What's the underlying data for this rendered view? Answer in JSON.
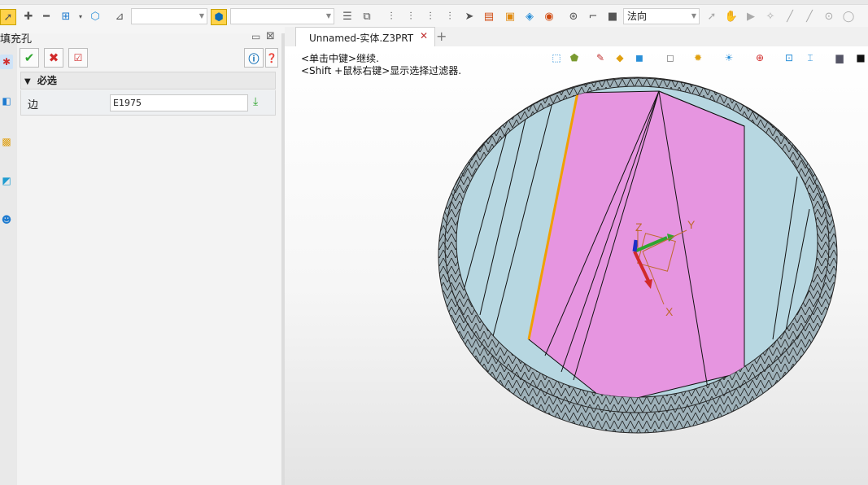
{
  "toolbar": {
    "filter_combo_1": "",
    "filter_combo_2": "",
    "view_combo": "法向",
    "icons": [
      "pointer-icon",
      "plus-icon",
      "minus-icon",
      "select-box-icon",
      "polygon-icon",
      "filter-icon",
      "pick-filter-icon",
      "align-icon",
      "stack-icon",
      "distribute-left-icon",
      "distribute-center-icon",
      "distribute-right-icon",
      "cursor-icon",
      "list-icon",
      "folder-icon",
      "layer-icon",
      "eye-icon",
      "compass-icon",
      "measure-icon",
      "stop-icon",
      "arrow-icon",
      "hand-icon",
      "play-icon",
      "snap-icon",
      "line-icon",
      "line2-icon",
      "circle-icon",
      "circle2-icon"
    ]
  },
  "panel": {
    "title": "填充孔",
    "section_label": "必选",
    "field_label": "边",
    "field_value": "E1975"
  },
  "tabs": [
    {
      "label": "Unnamed-实体.Z3PRT",
      "close": "✕"
    }
  ],
  "tab_add": "+",
  "viewport": {
    "hint_1": "<单击中键>继续.",
    "hint_2": "<Shift +鼠标右键>显示选择过滤器.",
    "axis_x": "X",
    "axis_y": "Y",
    "axis_z": "Z"
  },
  "colors": {
    "accent": "#0b6cb5",
    "confirm": "#2fa52f",
    "cancel": "#d12a2a",
    "face_pink": "#e695e0",
    "face_blue": "#b7d7e1",
    "rim": "#8fa3ab",
    "edge_highlight": "#f0a000"
  }
}
